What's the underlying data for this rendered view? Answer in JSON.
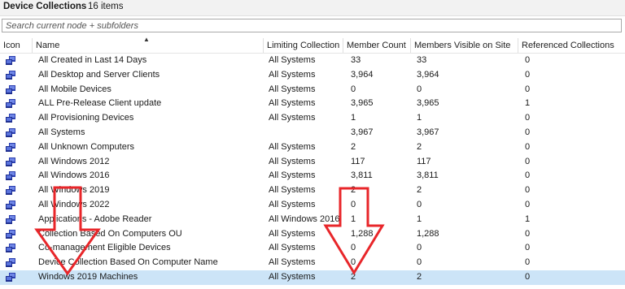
{
  "title": {
    "name": "Device Collections",
    "count": "16 items"
  },
  "search": {
    "placeholder": "Search current node + subfolders"
  },
  "columns": {
    "icon": "Icon",
    "name": "Name",
    "limiting": "Limiting Collection",
    "member_count": "Member Count",
    "visible": "Members Visible on Site",
    "referenced": "Referenced Collections"
  },
  "rows": [
    {
      "name": "All Created in Last 14 Days",
      "limiting": "All Systems",
      "member_count": "33",
      "visible": "33",
      "referenced": "0"
    },
    {
      "name": "All Desktop and Server Clients",
      "limiting": "All Systems",
      "member_count": "3,964",
      "visible": "3,964",
      "referenced": "0"
    },
    {
      "name": "All Mobile Devices",
      "limiting": "All Systems",
      "member_count": "0",
      "visible": "0",
      "referenced": "0"
    },
    {
      "name": "ALL Pre-Release Client update",
      "limiting": "All Systems",
      "member_count": "3,965",
      "visible": "3,965",
      "referenced": "1"
    },
    {
      "name": "All Provisioning Devices",
      "limiting": "All Systems",
      "member_count": "1",
      "visible": "1",
      "referenced": "0"
    },
    {
      "name": "All Systems",
      "limiting": "",
      "member_count": "3,967",
      "visible": "3,967",
      "referenced": "0"
    },
    {
      "name": "All Unknown Computers",
      "limiting": "All Systems",
      "member_count": "2",
      "visible": "2",
      "referenced": "0"
    },
    {
      "name": "All Windows 2012",
      "limiting": "All Systems",
      "member_count": "117",
      "visible": "117",
      "referenced": "0"
    },
    {
      "name": "All Windows 2016",
      "limiting": "All Systems",
      "member_count": "3,811",
      "visible": "3,811",
      "referenced": "0"
    },
    {
      "name": "All Windows 2019",
      "limiting": "All Systems",
      "member_count": "2",
      "visible": "2",
      "referenced": "0"
    },
    {
      "name": "All Windows 2022",
      "limiting": "All Systems",
      "member_count": "0",
      "visible": "0",
      "referenced": "0"
    },
    {
      "name": "Applications - Adobe Reader",
      "limiting": "All Windows 2016",
      "member_count": "1",
      "visible": "1",
      "referenced": "1"
    },
    {
      "name": "Collection Based On Computers OU",
      "limiting": "All Systems",
      "member_count": "1,288",
      "visible": "1,288",
      "referenced": "0"
    },
    {
      "name": "Co-management Eligible Devices",
      "limiting": "All Systems",
      "member_count": "0",
      "visible": "0",
      "referenced": "0"
    },
    {
      "name": "Device Collection Based On Computer Name",
      "limiting": "All Systems",
      "member_count": "0",
      "visible": "0",
      "referenced": "0"
    },
    {
      "name": "Windows 2019 Machines",
      "limiting": "All Systems",
      "member_count": "2",
      "visible": "2",
      "referenced": "0"
    }
  ],
  "selected_row": 15,
  "icon": "device-collection-icon",
  "colors": {
    "selection": "#cce4f7",
    "annotation_arrow": "#e8262a",
    "icon_blue": "#2b3fb0"
  }
}
